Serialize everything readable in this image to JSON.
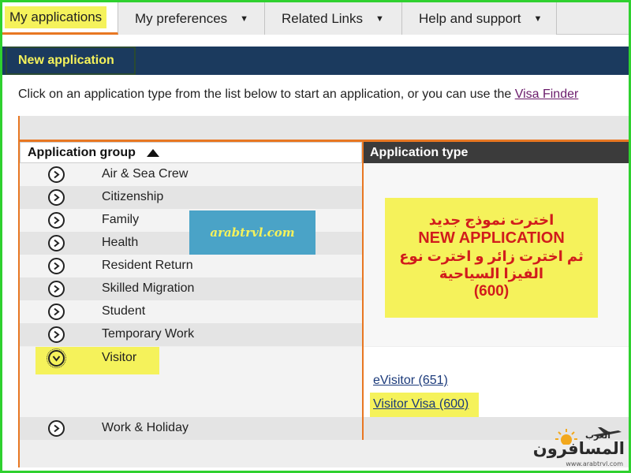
{
  "nav": {
    "tabs": [
      {
        "label": "My applications",
        "active": true,
        "dropdown": false
      },
      {
        "label": "My preferences",
        "active": false,
        "dropdown": true
      },
      {
        "label": "Related Links",
        "active": false,
        "dropdown": true
      },
      {
        "label": "Help and support",
        "active": false,
        "dropdown": true
      }
    ]
  },
  "header": {
    "title": "New application"
  },
  "intro": {
    "text": "Click on an application type from the list below to start an application, or you can use the",
    "link": "Visa Finder"
  },
  "table": {
    "group_header": "Application group",
    "type_header": "Application type",
    "groups": [
      "Air & Sea Crew",
      "Citizenship",
      "Family",
      "Health",
      "Resident Return",
      "Skilled Migration",
      "Student",
      "Temporary Work",
      "Visitor",
      "Work & Holiday"
    ],
    "expanded_group": "Visitor",
    "visitor_types": [
      "eVisitor (651)",
      "Visitor Visa (600)"
    ]
  },
  "watermark": {
    "text": "arabtrvl.com"
  },
  "callout": {
    "line1": "اخترت نموذج جديد",
    "line2": "NEW APPLICATION",
    "line3": "ثم اخترت زائر و اخترت نوع",
    "line4": "الفيزا السياحية",
    "line5": "(600)"
  },
  "logo": {
    "main": "المسافرون",
    "sub": "العرب",
    "url": "www.arabtrvl.com"
  },
  "colors": {
    "accent_orange": "#e87722",
    "highlight_yellow": "#f5f25b",
    "header_navy": "#1b3a5e",
    "callout_red": "#d11c1c",
    "frame_green": "#2fd12f"
  }
}
